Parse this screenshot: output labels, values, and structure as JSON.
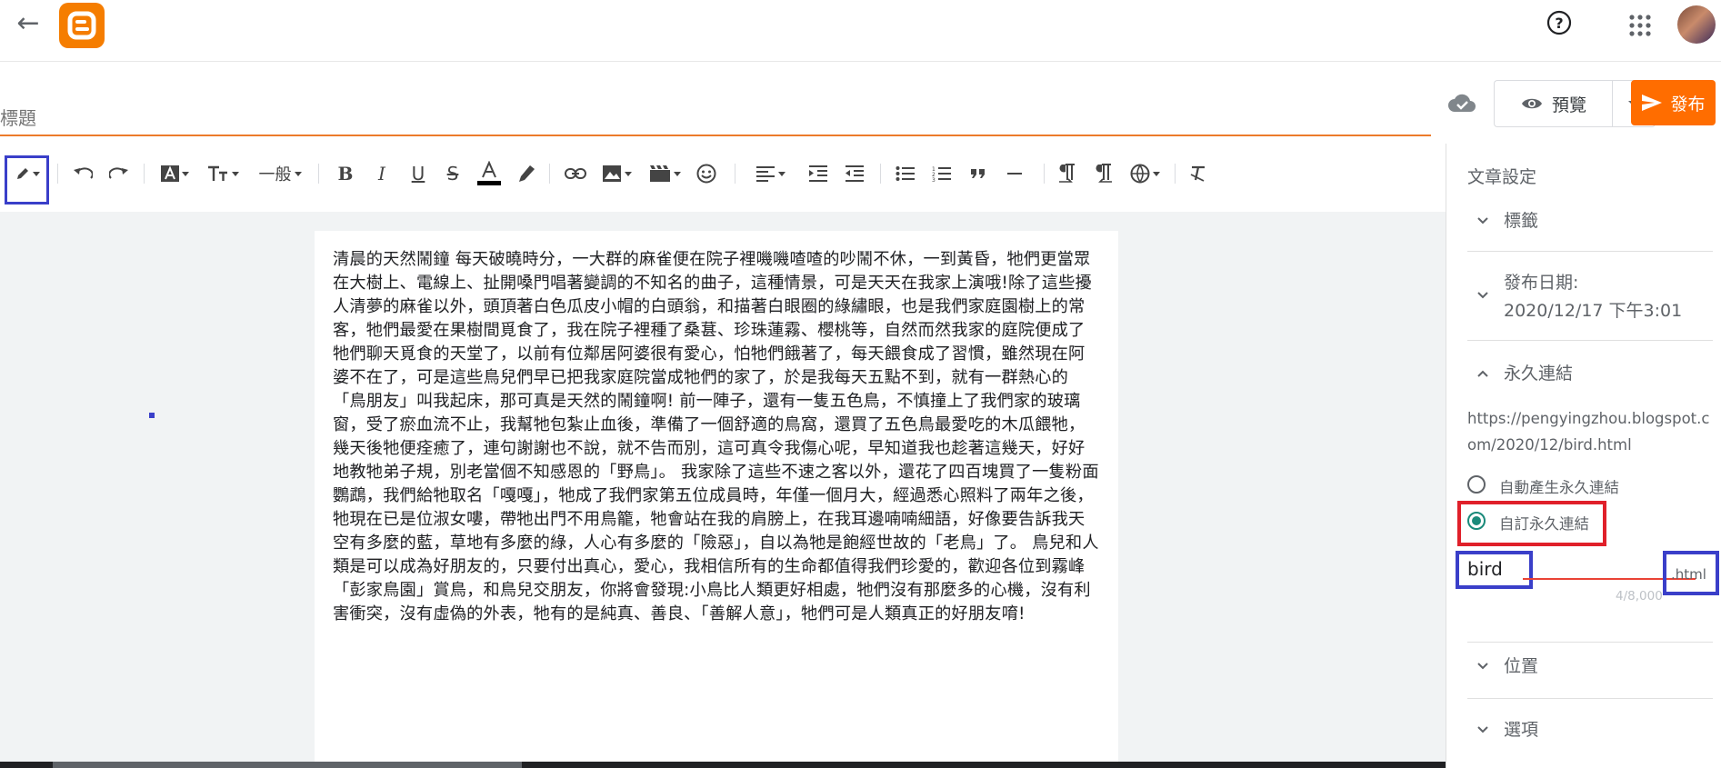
{
  "header": {
    "back_icon": "arrow-left-icon",
    "logo_icon": "blogger-logo-icon",
    "help_icon": "help-circle-icon",
    "apps_icon": "apps-grid-icon",
    "avatar_icon": "user-avatar"
  },
  "title_bar": {
    "title_placeholder": "標題",
    "cloud_icon": "cloud-saved-icon",
    "preview_label": "預覽",
    "publish_label": "發布",
    "accent_color": "#ff6d00"
  },
  "toolbar": {
    "paragraph_style": "一般",
    "icons": [
      "pencil-icon",
      "undo-icon",
      "redo-icon",
      "font-icon",
      "font-size-icon",
      "bold-icon",
      "italic-icon",
      "underline-icon",
      "strikethrough-icon",
      "text-color-icon",
      "highlight-icon",
      "link-icon",
      "image-icon",
      "video-icon",
      "emoji-icon",
      "align-icon",
      "indent-icon",
      "outdent-icon",
      "bulleted-list-icon",
      "numbered-list-icon",
      "quote-icon",
      "hr-icon",
      "ltr-icon",
      "rtl-icon",
      "language-icon",
      "clear-format-icon"
    ]
  },
  "post": {
    "body": "清晨的天然鬧鐘 每天破曉時分，一大群的麻雀便在院子裡嘰嘰喳喳的吵鬧不休，一到黃昏，牠們更當眾在大樹上、電線上、扯開嗓門唱著變調的不知名的曲子，這種情景，可是天天在我家上演哦!除了這些擾人清夢的麻雀以外，頭頂著白色瓜皮小帽的白頭翁，和描著白眼圈的綠繡眼，也是我們家庭園樹上的常客，牠們最愛在果樹間覓食了，我在院子裡種了桑葚、珍珠蓮霧、櫻桃等，自然而然我家的庭院便成了牠們聊天覓食的天堂了，以前有位鄰居阿婆很有愛心，怕牠們餓著了，每天餵食成了習慣，雖然現在阿婆不在了，可是這些鳥兒們早已把我家庭院當成牠們的家了，於是我每天五點不到，就有一群熱心的「鳥朋友」叫我起床，那可真是天然的鬧鐘啊! 前一陣子，還有一隻五色鳥，不慎撞上了我們家的玻璃窗，受了瘀血流不止，我幫牠包紮止血後，準備了一個舒適的鳥窩，還買了五色鳥最愛吃的木瓜餵牠，幾天後牠便痊癒了，連句謝謝也不說，就不告而別，這可真令我傷心呢，早知道我也趁著這幾天，好好地教牠弟子規，別老當個不知感恩的「野鳥」。 我家除了這些不速之客以外，還花了四百塊買了一隻粉面鸚鵡，我們給牠取名「嘎嘎」，牠成了我們家第五位成員時，年僅一個月大，經過悉心照料了兩年之後，牠現在已是位淑女嘍，帶牠出門不用鳥籠，牠會站在我的肩膀上，在我耳邊喃喃細語，好像要告訴我天空有多麼的藍，草地有多麼的綠，人心有多麼的「險惡」，自以為牠是飽經世故的「老鳥」了。 鳥兒和人類是可以成為好朋友的，只要付出真心，愛心，我相信所有的生命都值得我們珍愛的，歡迎各位到霧峰「彭家鳥園」賞鳥，和鳥兒交朋友，你將會發現:小鳥比人類更好相處，牠們沒有那麼多的心機，沒有利害衝突，沒有虛偽的外表，牠有的是純真、善良、「善解人意」，牠們可是人類真正的好朋友唷!"
  },
  "settings": {
    "panel_title": "文章設定",
    "labels_section": "標籤",
    "publish_date_label": "發布日期:",
    "publish_date_value": "2020/12/17 下午3:01",
    "permalink_section": "永久連結",
    "permalink_url": "https://pengyingzhou.blogspot.com/2020/12/bird.html",
    "auto_permalink_label": "自動產生永久連結",
    "custom_permalink_label": "自訂永久連結",
    "custom_permalink_value": "bird",
    "html_suffix": ".html",
    "char_counter": "4/8,000",
    "location_section": "位置",
    "options_section": "選項"
  }
}
